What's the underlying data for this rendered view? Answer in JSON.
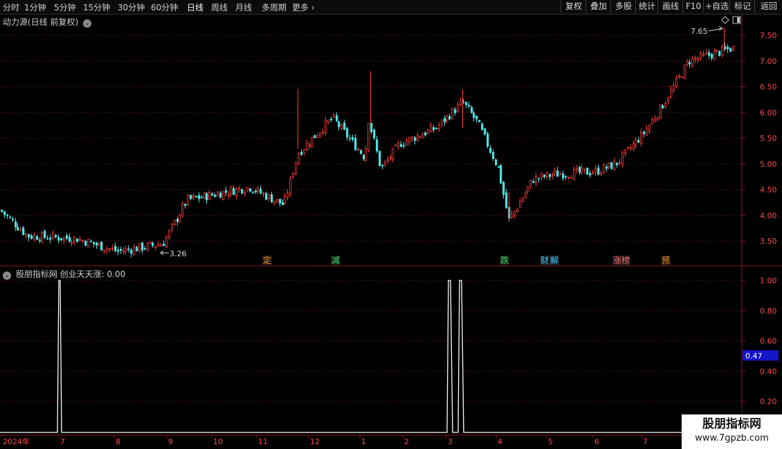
{
  "toolbar": {
    "timeframes": [
      "分时",
      "1分钟",
      "5分钟",
      "15分钟",
      "30分钟",
      "60分钟",
      "日线",
      "周线",
      "月线",
      "多周期",
      "更多 ›"
    ],
    "active_index": 6,
    "right_buttons": [
      "复权",
      "叠加",
      "多股",
      "统计",
      "画线",
      "F10",
      "+自选",
      "返回"
    ]
  },
  "main_panel": {
    "title": "动力源(日线 前复权)",
    "high_label": "7.65",
    "low_label": "3.26",
    "y_ticks": [
      "7.50",
      "7.00",
      "6.50",
      "6.00",
      "5.50",
      "5.00",
      "4.50",
      "4.00",
      "3.50"
    ],
    "markers": [
      {
        "text": "定",
        "color": "#ff8a1a"
      },
      {
        "text": "减",
        "color": "#2ee05a"
      },
      {
        "text": "跌",
        "color": "#2ee05a"
      },
      {
        "text": "财",
        "color": "#39c6ff"
      },
      {
        "text": "解",
        "color": "#39c6ff"
      },
      {
        "text": "涨榜",
        "color": "#ff6a6a"
      },
      {
        "text": "预",
        "color": "#ff8a1a"
      }
    ]
  },
  "indicator_panel": {
    "title": "股朋指标网  创业天天涨: 0.00",
    "y_ticks": [
      "1.00",
      "0.80",
      "0.60",
      "0.40",
      "0.20"
    ],
    "current_value": "0.47"
  },
  "time_axis": [
    "2024年",
    "7",
    "8",
    "9",
    "10",
    "11",
    "12",
    "1",
    "2",
    "3",
    "4",
    "5",
    "6",
    "7"
  ],
  "watermark": {
    "line1": "股朋指标网",
    "line2": "www.7gpzb.com"
  },
  "chart_data": {
    "type": "candlestick",
    "price_ylim": [
      3.0,
      7.8
    ],
    "indicator_ylim": [
      0.0,
      1.0
    ],
    "x_labels": [
      "7",
      "8",
      "9",
      "10",
      "11",
      "12",
      "1",
      "2",
      "3",
      "4",
      "5",
      "6",
      "7"
    ],
    "close_anchors": [
      [
        "start",
        4.1
      ],
      [
        "7",
        3.6
      ],
      [
        "8",
        3.55
      ],
      [
        "9",
        3.3
      ],
      [
        "9 mid",
        3.45
      ],
      [
        "10",
        4.3
      ],
      [
        "10 mid",
        4.4
      ],
      [
        "11",
        4.55
      ],
      [
        "11 late",
        4.2
      ],
      [
        "12",
        5.2
      ],
      [
        "12 mid",
        5.9
      ],
      [
        "1",
        5.1
      ],
      [
        "1 mid",
        6.0
      ],
      [
        "2",
        4.9
      ],
      [
        "2 mid",
        5.4
      ],
      [
        "3",
        5.7
      ],
      [
        "3 mid",
        6.2
      ],
      [
        "3 late",
        5.8
      ],
      [
        "4",
        4.9
      ],
      [
        "4 low",
        3.9
      ],
      [
        "5",
        4.7
      ],
      [
        "5 mid",
        4.8
      ],
      [
        "6",
        4.85
      ],
      [
        "6 late",
        5.0
      ],
      [
        "7",
        5.6
      ],
      [
        "7 mid",
        6.2
      ],
      [
        "7 late",
        7.0
      ],
      [
        "end",
        7.25
      ]
    ],
    "indicator_signals": [
      {
        "date": "7",
        "value": 1.0
      },
      {
        "date": "3",
        "value": 1.0
      },
      {
        "date": "3",
        "value": 1.0
      }
    ]
  }
}
